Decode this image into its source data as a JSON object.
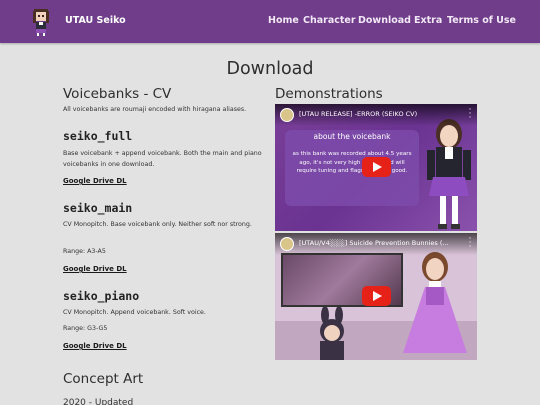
{
  "header": {
    "brand": "UTAU Seiko",
    "nav": [
      "Home",
      "Character",
      "Download",
      "Extra",
      "Terms of Use"
    ]
  },
  "page_title": "Download",
  "voicebanks": {
    "heading": "Voicebanks - CV",
    "intro": "All voicebanks are roumaji encoded with hiragana aliases.",
    "banks": [
      {
        "name": "seiko_full",
        "description": "Base voicebank + append voicebank. Both the main and piano voicebanks in one download.",
        "range": "",
        "link": "Google Drive DL"
      },
      {
        "name": "seiko_main",
        "description": "CV Monopitch. Base voicebank only. Neither soft nor strong.",
        "range": "Range: A3-A5",
        "link": "Google Drive DL"
      },
      {
        "name": "seiko_piano",
        "description": "CV Monopitch. Append voicebank. Soft voice.",
        "range": "Range: G3-G5",
        "link": "Google Drive DL"
      }
    ]
  },
  "concept_art": {
    "heading": "Concept Art",
    "subheading": "2020 - Updated"
  },
  "demonstrations": {
    "heading": "Demonstrations",
    "videos": [
      {
        "title": "[UTAU RELEASE] -ERROR (SEIKO CV)",
        "card_heading": "about the voicebank",
        "card_text": "as this bank was recorded about 4.5 years ago, it's not very high quality and will require tuning and flags to sound good."
      },
      {
        "title": "[UTAU/V4░░░] Suicide Prevention Bunnies (..."
      }
    ]
  },
  "colors": {
    "header_bg": "#6f3d8a",
    "page_bg": "#e2e2e2",
    "play_red": "#e62117"
  }
}
